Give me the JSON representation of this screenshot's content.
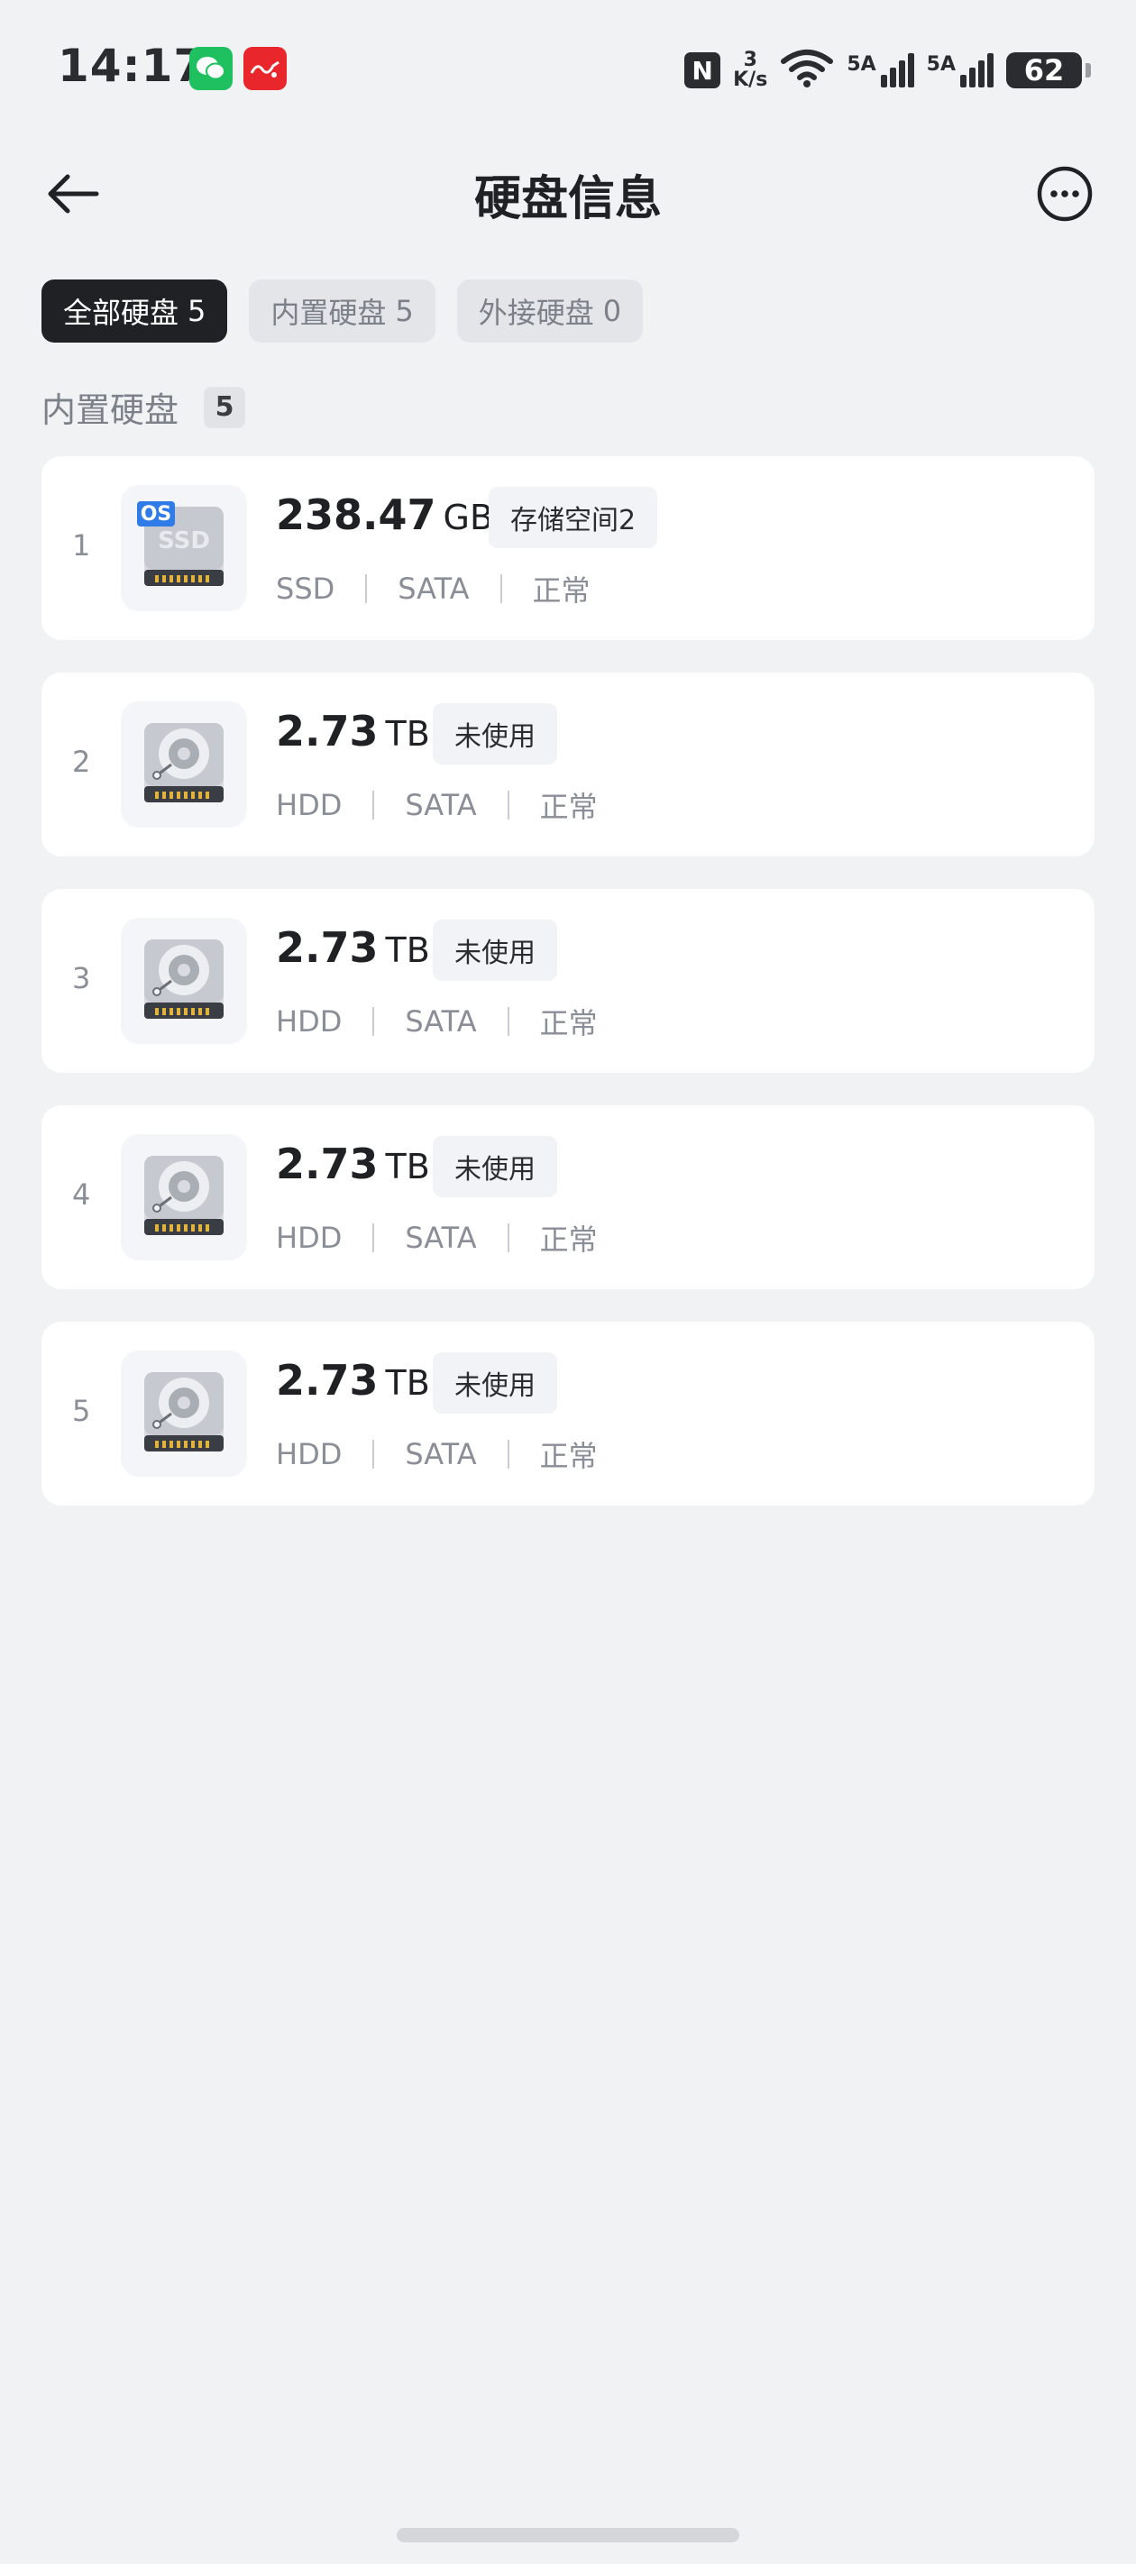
{
  "status_bar": {
    "time": "14:17",
    "nfc": "N",
    "speed_value": "3",
    "speed_unit": "K/s",
    "signal1_label": "5A",
    "signal2_label": "5A",
    "battery": "62",
    "wechat_color": "#1fc05f",
    "other_app_color": "#e8262c"
  },
  "header": {
    "title": "硬盘信息"
  },
  "tabs": [
    {
      "label": "全部硬盘",
      "count": "5",
      "active": true
    },
    {
      "label": "内置硬盘",
      "count": "5",
      "active": false
    },
    {
      "label": "外接硬盘",
      "count": "0",
      "active": false
    }
  ],
  "section": {
    "title": "内置硬盘",
    "count": "5"
  },
  "disks": [
    {
      "index": "1",
      "size": "238.47",
      "unit": "GB",
      "tag": "存储空间2",
      "type": "SSD",
      "interface": "SATA",
      "status": "正常",
      "icon": "ssd-icon",
      "os_badge": "OS",
      "icon_label": "SSD"
    },
    {
      "index": "2",
      "size": "2.73",
      "unit": "TB",
      "tag": "未使用",
      "type": "HDD",
      "interface": "SATA",
      "status": "正常",
      "icon": "hdd-icon"
    },
    {
      "index": "3",
      "size": "2.73",
      "unit": "TB",
      "tag": "未使用",
      "type": "HDD",
      "interface": "SATA",
      "status": "正常",
      "icon": "hdd-icon"
    },
    {
      "index": "4",
      "size": "2.73",
      "unit": "TB",
      "tag": "未使用",
      "type": "HDD",
      "interface": "SATA",
      "status": "正常",
      "icon": "hdd-icon"
    },
    {
      "index": "5",
      "size": "2.73",
      "unit": "TB",
      "tag": "未使用",
      "type": "HDD",
      "interface": "SATA",
      "status": "正常",
      "icon": "hdd-icon"
    }
  ],
  "colors": {
    "background": "#f1f2f4",
    "active_tab": "#1f2124",
    "os_badge": "#2f7be8"
  }
}
